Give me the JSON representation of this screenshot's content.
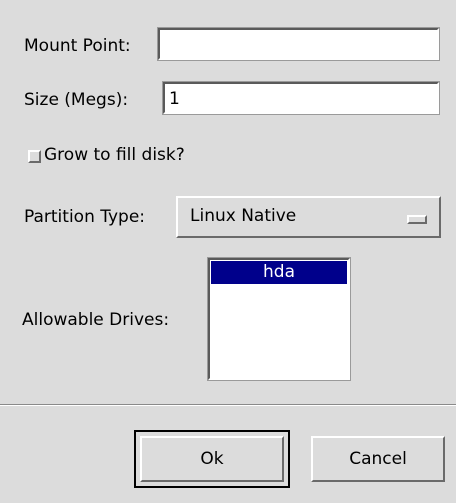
{
  "form": {
    "mount_point": {
      "label": "Mount Point:",
      "value": ""
    },
    "size": {
      "label": "Size (Megs):",
      "value": "1"
    },
    "grow": {
      "label": "Grow to fill disk?",
      "checked": false
    },
    "partition_type": {
      "label": "Partition Type:",
      "selected": "Linux Native"
    },
    "allowable_drives": {
      "label": "Allowable Drives:",
      "items": [
        "hda"
      ],
      "selected_index": 0
    }
  },
  "buttons": {
    "ok_label": "Ok",
    "cancel_label": "Cancel"
  },
  "colors": {
    "background": "#dcdcdc",
    "selection": "#00008b",
    "selection_text": "#ffffff"
  }
}
